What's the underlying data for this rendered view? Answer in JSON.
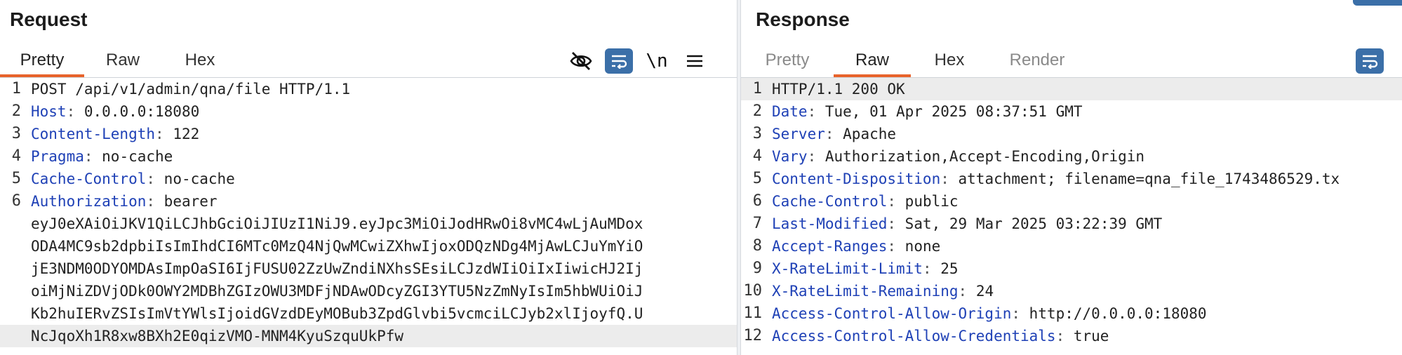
{
  "request": {
    "title": "Request",
    "tabs": [
      {
        "label": "Pretty",
        "active": true
      },
      {
        "label": "Raw",
        "active": false
      },
      {
        "label": "Hex",
        "active": false
      }
    ],
    "toolbar": {
      "hide_icon": "eye-slash-icon",
      "wrap_icon": "wrap-lines-icon",
      "newline_label": "\\n",
      "menu_icon": "hamburger-menu-icon"
    },
    "lines": [
      {
        "num": "1",
        "text": "POST /api/v1/admin/qna/file HTTP/1.1"
      },
      {
        "num": "2",
        "name": "Host",
        "value": " 0.0.0.0:18080"
      },
      {
        "num": "3",
        "name": "Content-Length",
        "value": " 122"
      },
      {
        "num": "4",
        "name": "Pragma",
        "value": " no-cache"
      },
      {
        "num": "5",
        "name": "Cache-Control",
        "value": " no-cache"
      },
      {
        "num": "6",
        "name": "Authorization",
        "value": " bearer"
      },
      {
        "num": "",
        "text": "eyJ0eXAiOiJKV1QiLCJhbGciOiJIUzI1NiJ9.eyJpc3MiOiJodHRwOi8vMC4wLjAuMDox"
      },
      {
        "num": "",
        "text": "ODA4MC9sb2dpbiIsImIhdCI6MTc0MzQ4NjQwMCwiZXhwIjoxODQzNDg4MjAwLCJuYmYiO"
      },
      {
        "num": "",
        "text": "jE3NDM0ODYOMDAsImpOaSI6IjFUSU02ZzUwZndiNXhsSEsiLCJzdWIiOiIxIiwicHJ2Ij"
      },
      {
        "num": "",
        "text": "oiMjNiZDVjODk0OWY2MDBhZGIzOWU3MDFjNDAwODcyZGI3YTU5NzZmNyIsIm5hbWUiOiJ"
      },
      {
        "num": "",
        "text": "Kb2huIERvZSIsImVtYWlsIjoidGVzdDEyMOBub3ZpdGlvbi5vcmciLCJyb2xlIjoyfQ.U"
      },
      {
        "num": "",
        "text": "NcJqoXh1R8xw8BXh2E0qizVMO-MNM4KyuSzquUkPfw",
        "highlight": true
      }
    ]
  },
  "response": {
    "title": "Response",
    "tabs": [
      {
        "label": "Pretty",
        "active": false,
        "muted": true
      },
      {
        "label": "Raw",
        "active": true
      },
      {
        "label": "Hex",
        "active": false
      },
      {
        "label": "Render",
        "active": false,
        "muted": true
      }
    ],
    "toolbar": {
      "wrap_icon": "wrap-lines-icon"
    },
    "lines": [
      {
        "num": "1",
        "text": "HTTP/1.1 200 OK",
        "highlight": true
      },
      {
        "num": "2",
        "name": "Date",
        "value": " Tue, 01 Apr 2025 08:37:51 GMT"
      },
      {
        "num": "3",
        "name": "Server",
        "value": " Apache"
      },
      {
        "num": "4",
        "name": "Vary",
        "value": " Authorization,Accept-Encoding,Origin"
      },
      {
        "num": "5",
        "name": "Content-Disposition",
        "value": " attachment; filename=qna_file_1743486529.tx"
      },
      {
        "num": "6",
        "name": "Cache-Control",
        "value": " public"
      },
      {
        "num": "7",
        "name": "Last-Modified",
        "value": " Sat, 29 Mar 2025 03:22:39 GMT"
      },
      {
        "num": "8",
        "name": "Accept-Ranges",
        "value": " none"
      },
      {
        "num": "9",
        "name": "X-RateLimit-Limit",
        "value": " 25"
      },
      {
        "num": "10",
        "name": "X-RateLimit-Remaining",
        "value": " 24"
      },
      {
        "num": "11",
        "name": "Access-Control-Allow-Origin",
        "value": " http://0.0.0.0:18080"
      },
      {
        "num": "12",
        "name": "Access-Control-Allow-Credentials",
        "value": " true"
      }
    ]
  },
  "colors": {
    "accent_tab": "#e8632b",
    "header_name": "#1f41b6",
    "button_blue": "#3b6fa8"
  }
}
